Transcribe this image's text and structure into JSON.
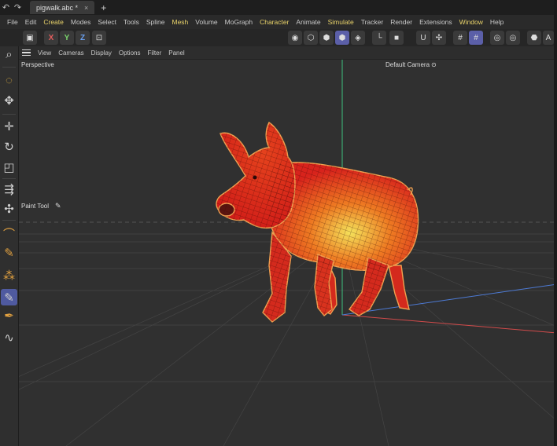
{
  "tabbar": {
    "undo_icon": "undo-icon",
    "redo_icon": "redo-icon",
    "document_tab": "pigwalk.abc *",
    "close_glyph": "×",
    "new_tab_glyph": "+"
  },
  "menubar": {
    "items": [
      "File",
      "Edit",
      "Create",
      "Modes",
      "Select",
      "Tools",
      "Spline",
      "Mesh",
      "Volume",
      "MoGraph",
      "Character",
      "Animate",
      "Simulate",
      "Tracker",
      "Render",
      "Extensions",
      "Window",
      "Help"
    ],
    "highlighted": [
      "Create",
      "Mesh",
      "Character",
      "Simulate",
      "Window"
    ],
    "highlight_color": "#e9d36a"
  },
  "toolbar": {
    "axis_x": "X",
    "axis_y": "Y",
    "axis_z": "Z",
    "active_color": "#5b5fa8"
  },
  "viewport_menu": {
    "items": [
      "View",
      "Cameras",
      "Display",
      "Options",
      "Filter",
      "Panel"
    ]
  },
  "viewport": {
    "view_name": "Perspective",
    "camera_name": "Default Camera",
    "camera_glyph": "⊙",
    "active_tool": "Paint Tool",
    "pen_glyph": "✎"
  },
  "colors": {
    "background": "#303030",
    "mesh_red": "#e0281e",
    "mesh_highlight": "#f1d24a",
    "axis_x": "#d24b4b",
    "axis_y": "#3ec17e",
    "axis_z": "#4d7ad4"
  }
}
